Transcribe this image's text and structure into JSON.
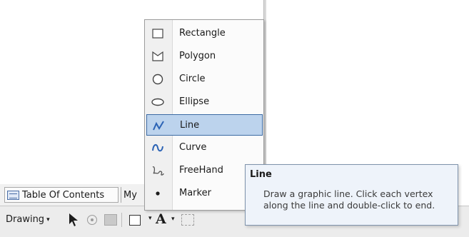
{
  "menu": {
    "items": [
      {
        "label": "Rectangle",
        "icon": "rectangle-icon"
      },
      {
        "label": "Polygon",
        "icon": "polygon-icon"
      },
      {
        "label": "Circle",
        "icon": "circle-icon"
      },
      {
        "label": "Ellipse",
        "icon": "ellipse-icon"
      },
      {
        "label": "Line",
        "icon": "line-icon",
        "selected": true
      },
      {
        "label": "Curve",
        "icon": "curve-icon"
      },
      {
        "label": "FreeHand",
        "icon": "freehand-icon"
      },
      {
        "label": "Marker",
        "icon": "marker-icon"
      }
    ]
  },
  "tooltip": {
    "title": "Line",
    "body": "Draw a graphic line. Click each vertex along the line and double-click to end."
  },
  "tabs": {
    "toc_label": "Table Of Contents",
    "my_label": "My"
  },
  "toolbar": {
    "drawing_label": "Drawing",
    "caret": "▾",
    "font_label": "A"
  },
  "colors": {
    "selection_fill": "#bcd3ed",
    "selection_border": "#3c6aa3",
    "icon_blue": "#2b63b5",
    "tooltip_bg": "#eef3fa"
  }
}
